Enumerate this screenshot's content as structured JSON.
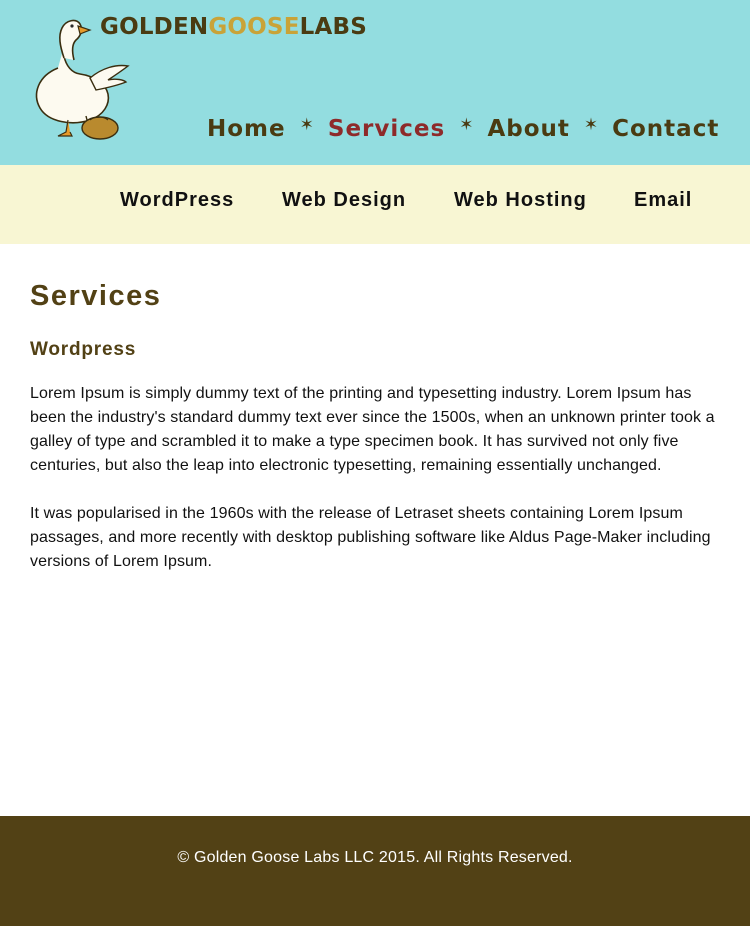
{
  "brand": {
    "name_part1": "GOLDEN",
    "name_part2": "GOOSE",
    "name_part3": "LABS",
    "color_dark": "#4a3b12",
    "color_gold": "#c9a338"
  },
  "colors": {
    "header_bg": "#93dde0",
    "subnav_bg": "#f8f6d3",
    "nav_text": "#4a3b12",
    "nav_active": "#8e2a2a",
    "heading": "#524115",
    "footer_bg": "#524115"
  },
  "main_nav": {
    "items": [
      {
        "label": "Home",
        "active": false
      },
      {
        "label": "Services",
        "active": true
      },
      {
        "label": "About",
        "active": false
      },
      {
        "label": "Contact",
        "active": false
      }
    ],
    "separator": "✶"
  },
  "sub_nav": {
    "items": [
      {
        "label": "WordPress"
      },
      {
        "label": "Web Design"
      },
      {
        "label": "Web Hosting"
      },
      {
        "label": "Email"
      }
    ]
  },
  "content": {
    "title": "Services",
    "subtitle": "Wordpress",
    "paragraph1": "Lorem Ipsum is simply dummy text of the printing and typesetting industry. Lorem Ipsum has been the industry's standard dummy text ever since the 1500s, when an unknown printer took a galley of type and scrambled it to make a type specimen book. It has survived not only five centuries, but also the leap into electronic typesetting, remaining essentially unchanged.",
    "paragraph2": "It was popularised in the 1960s with the release of Letraset sheets containing Lorem Ipsum passages, and more recently with desktop publishing software like Aldus Page-Maker including versions of Lorem Ipsum."
  },
  "footer": {
    "copyright": "© Golden Goose Labs LLC 2015. All Rights Reserved."
  }
}
